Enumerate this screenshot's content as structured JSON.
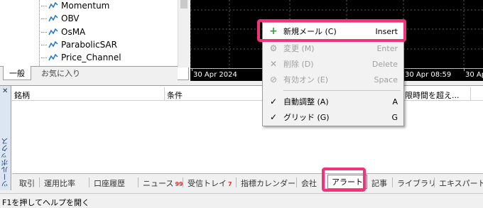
{
  "navigator": {
    "items": [
      {
        "label": "Momentum"
      },
      {
        "label": "OBV"
      },
      {
        "label": "OsMA"
      },
      {
        "label": "ParabolicSAR"
      },
      {
        "label": "Price_Channel"
      }
    ],
    "tabs": [
      {
        "label": "一般",
        "active": true
      },
      {
        "label": "お気に入り",
        "active": false
      }
    ]
  },
  "chart": {
    "dates": [
      "30 Apr 2024",
      "30 Apr 08:59",
      "30 Apr 16:"
    ]
  },
  "context_menu": {
    "items": [
      {
        "icon": "+",
        "label": "新規メール (C)",
        "shortcut": "Insert",
        "enabled": true
      },
      {
        "icon": "⚙",
        "label": "変更 (M)",
        "shortcut": "Enter",
        "enabled": false
      },
      {
        "icon": "✕",
        "label": "削除 (D)",
        "shortcut": "Delete",
        "enabled": false
      },
      {
        "icon": "⊘",
        "label": "有効オン (E)",
        "shortcut": "Space",
        "enabled": false
      },
      {
        "icon": "✓",
        "label": "自動調整 (A)",
        "shortcut": "A",
        "enabled": true
      },
      {
        "icon": "✓",
        "label": "グリッド (G)",
        "shortcut": "G",
        "enabled": true
      }
    ],
    "accent": "#f0337a"
  },
  "toolbox": {
    "title": "ツールボックス",
    "columns": [
      "銘柄",
      "条件",
      "限時間を超え..."
    ],
    "tabs": [
      {
        "label": "取引"
      },
      {
        "label": "運用比率"
      },
      {
        "label": "口座履歴"
      },
      {
        "label": "ニュース",
        "badge": "99"
      },
      {
        "label": "受信トレイ",
        "badge": "7"
      },
      {
        "label": "指標カレンダー"
      },
      {
        "label": "会社"
      },
      {
        "label": "アラート",
        "active": true
      },
      {
        "label": "記事"
      },
      {
        "label": "ライブラリ"
      },
      {
        "label": "エキスパート"
      }
    ]
  },
  "statusbar": {
    "text": "F1を押してヘルプを開く"
  }
}
